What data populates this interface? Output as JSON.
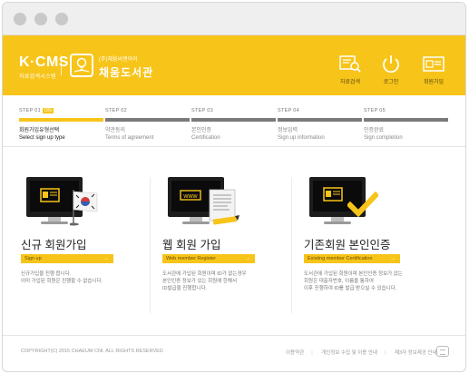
{
  "header": {
    "brand": {
      "name": "K·CMS",
      "tagline": "자료검색시스템"
    },
    "library": {
      "org": "(주)채움씨앤아이",
      "name": "채움도서관"
    },
    "nav": [
      {
        "label": "자료검색",
        "icon": "search-catalog-icon"
      },
      {
        "label": "로그인",
        "icon": "power-icon"
      },
      {
        "label": "회원가입",
        "icon": "member-card-icon"
      }
    ],
    "accent_color": "#f7c419"
  },
  "steps": [
    {
      "num": "STEP 01",
      "badge": "ON",
      "kr": "회원가입유형선택",
      "en": "Select sign up type",
      "active": true
    },
    {
      "num": "STEP 02",
      "kr": "약관동의",
      "en": "Terms of agreement"
    },
    {
      "num": "STEP 03",
      "kr": "본인인증",
      "en": "Certification"
    },
    {
      "num": "STEP 04",
      "kr": "정보입력",
      "en": "Sign up information"
    },
    {
      "num": "STEP 05",
      "kr": "인증완료",
      "en": "Sign completion"
    }
  ],
  "cards": [
    {
      "title": "신규 회원가입",
      "button": "Sign up",
      "desc": "신규가입을 진행 합니다.\n이미 가입된 회원은 진행할 수 없습니다.",
      "illustration": "id-card-flag-icon"
    },
    {
      "title": "웹 회원 가입",
      "button": "Web member Register",
      "desc": "도서관에 가입된 회원이며 ID가 없는경우\n본인인증 정보가 있는 회원에 한해서\nID발급을 진행합니다.",
      "illustration": "www-document-icon"
    },
    {
      "title": "기존회원 본인인증",
      "button": "Existing member Certification",
      "desc": "도서관에 가입된 회원이며 본인인증 정보가 없는\n회원은 대출자번호, 이름을 통하여\n이후 진행하여 ID를 발급 받으실 수 있습니다.",
      "illustration": "id-check-icon"
    }
  ],
  "footer": {
    "copyright": "COPYRIGHT(C) 2015 CHAEUM CNI. ALL RIGHTS RESERVED",
    "links": [
      "이용약관",
      "개인정보 수집 및 이용 안내",
      "제3자 정보제공 안내"
    ]
  }
}
